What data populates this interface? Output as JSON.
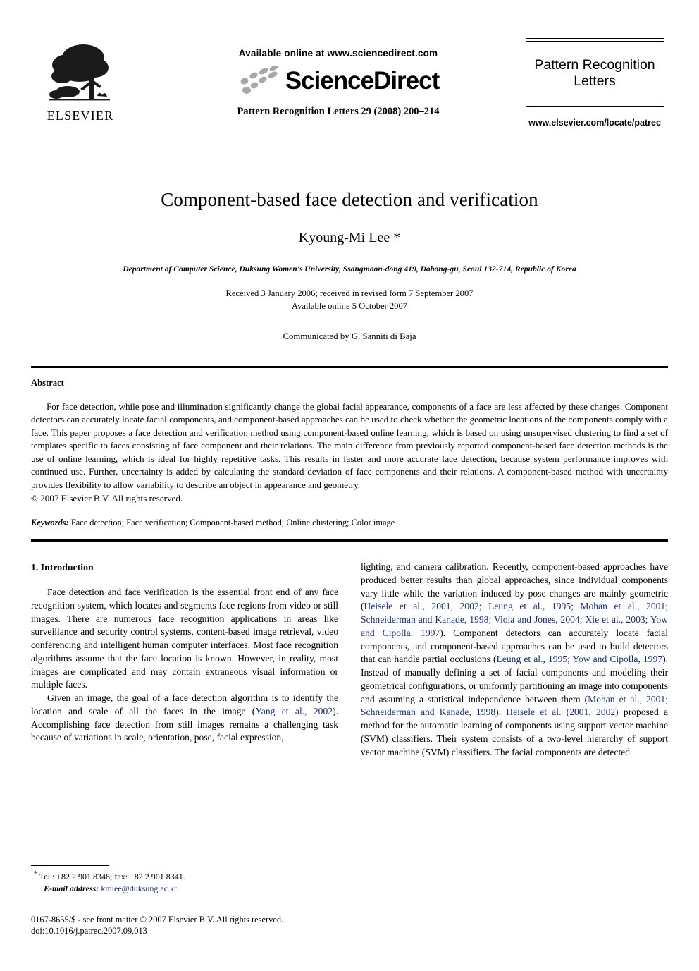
{
  "masthead": {
    "publisher_name": "ELSEVIER",
    "available_online": "Available online at www.sciencedirect.com",
    "sciencedirect_wordmark": "ScienceDirect",
    "journal_reference": "Pattern Recognition Letters 29 (2008) 200–214",
    "journal_title_line1": "Pattern Recognition",
    "journal_title_line2": "Letters",
    "journal_url": "www.elsevier.com/locate/patrec"
  },
  "title_block": {
    "title": "Component-based face detection and verification",
    "authors": "Kyoung-Mi Lee *",
    "affiliation": "Department of Computer Science, Duksung Women's University, Ssangmoon-dong 419, Dobong-gu, Seoul 132-714, Republic of Korea",
    "received": "Received 3 January 2006; received in revised form 7 September 2007",
    "available": "Available online 5 October 2007",
    "communicated": "Communicated by G. Sanniti di Baja"
  },
  "abstract": {
    "heading": "Abstract",
    "text": "For face detection, while pose and illumination significantly change the global facial appearance, components of a face are less affected by these changes. Component detectors can accurately locate facial components, and component-based approaches can be used to check whether the geometric locations of the components comply with a face. This paper proposes a face detection and verification method using component-based online learning, which is based on using unsupervised clustering to find a set of templates specific to faces consisting of face component and their relations. The main difference from previously reported component-based face detection methods is the use of online learning, which is ideal for highly repetitive tasks. This results in faster and more accurate face detection, because system performance improves with continued use. Further, uncertainty is added by calculating the standard deviation of face components and their relations. A component-based method with uncertainty provides flexibility to allow variability to describe an object in appearance and geometry.",
    "copyright": "© 2007 Elsevier B.V. All rights reserved.",
    "keywords_label": "Keywords:",
    "keywords_text": "Face detection; Face verification; Component-based method; Online clustering; Color image"
  },
  "body": {
    "section_heading": "1. Introduction",
    "left_column": {
      "para1": "Face detection and face verification is the essential front end of any face recognition system, which locates and segments face regions from video or still images. There are numerous face recognition applications in areas like surveillance and security control systems, content-based image retrieval, video conferencing and intelligent human computer interfaces. Most face recognition algorithms assume that the face location is known. However, in reality, most images are complicated and may contain extraneous visual information or multiple faces.",
      "para2_pre": "Given an image, the goal of a face detection algorithm is to identify the location and scale of all the faces in the image (",
      "para2_cite1": "Yang et al., 2002",
      "para2_post": "). Accomplishing face detection from still images remains a challenging task because of variations in scale, orientation, pose, facial expression,"
    },
    "right_column": {
      "part1": "lighting, and camera calibration. Recently, component-based approaches have produced better results than global approaches, since individual components vary little while the variation induced by pose changes are mainly geometric (",
      "cite1": "Heisele et al., 2001, 2002; Leung et al., 1995; Mohan et al., 2001; Schneiderman and Kanade, 1998; Viola and Jones, 2004; Xie et al., 2003; Yow and Cipolla, 1997",
      "part2": "). Component detectors can accurately locate facial components, and component-based approaches can be used to build detectors that can handle partial occlusions (",
      "cite2": "Leung et al., 1995; Yow and Cipolla, 1997",
      "part3": "). Instead of manually defining a set of facial components and modeling their geometrical configurations, or uniformly partitioning an image into components and assuming a statistical independence between them (",
      "cite3": "Mohan et al., 2001; Schneiderman and Kanade, 1998",
      "part4": "), ",
      "cite4": "Heisele et al. (2001, 2002)",
      "part5": " proposed a method for the automatic learning of components using support vector machine (SVM) classifiers. Their system consists of a two-level hierarchy of support vector machine (SVM) classifiers. The facial components are detected"
    }
  },
  "footnotes": {
    "corresponding_marker": "*",
    "tel_fax": "Tel.: +82 2 901 8348; fax: +82 2 901 8341.",
    "email_label": "E-mail address:",
    "email_address": "kmlee@duksung.ac.kr",
    "issn_line": "0167-8655/$ - see front matter © 2007 Elsevier B.V. All rights reserved.",
    "doi_line": "doi:10.1016/j.patrec.2007.09.013"
  },
  "colors": {
    "citation_link": "#1a2c7a",
    "text": "#000000",
    "background": "#ffffff"
  }
}
